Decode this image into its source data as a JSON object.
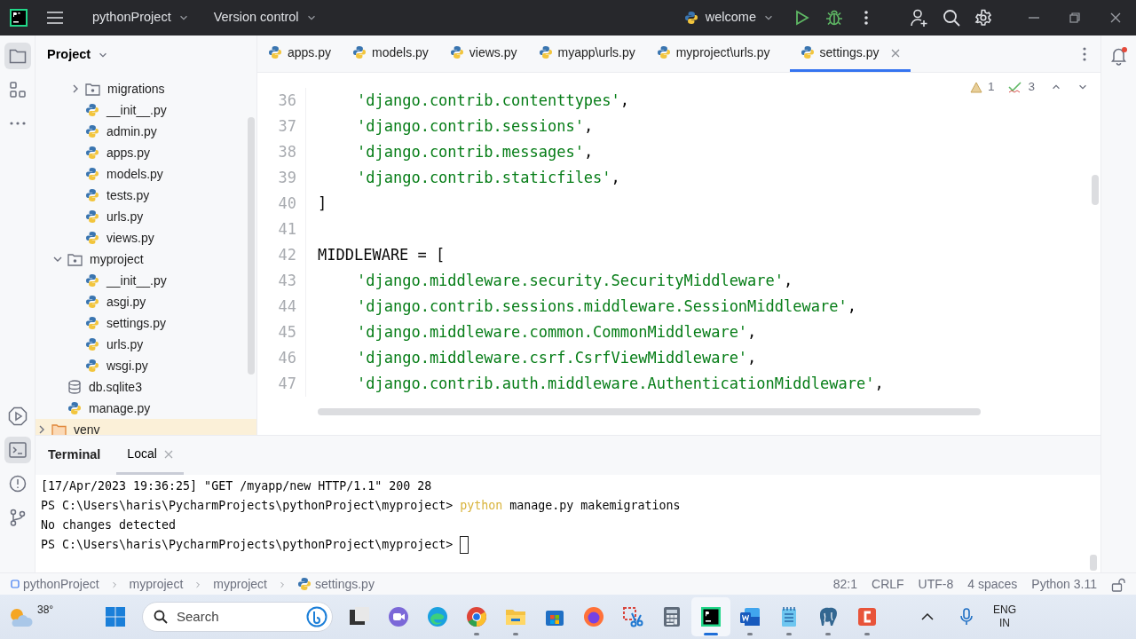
{
  "title_bar": {
    "project": "pythonProject",
    "vcs": "Version control",
    "run_config": "welcome"
  },
  "project_panel": {
    "title": "Project",
    "tree": [
      {
        "children": [
          {
            "children": [
              {
                "label": "migrations",
                "kind": "package",
                "expanded": false
              },
              {
                "label": "__init__.py",
                "kind": "python"
              },
              {
                "label": "admin.py",
                "kind": "python"
              },
              {
                "label": "apps.py",
                "kind": "python"
              },
              {
                "label": "models.py",
                "kind": "python"
              },
              {
                "label": "tests.py",
                "kind": "python"
              },
              {
                "label": "urls.py",
                "kind": "python"
              },
              {
                "label": "views.py",
                "kind": "python"
              }
            ]
          },
          {
            "label": "myproject",
            "kind": "package",
            "expanded": true,
            "children": [
              {
                "label": "__init__.py",
                "kind": "python"
              },
              {
                "label": "asgi.py",
                "kind": "python"
              },
              {
                "label": "settings.py",
                "kind": "python"
              },
              {
                "label": "urls.py",
                "kind": "python"
              },
              {
                "label": "wsgi.py",
                "kind": "python"
              }
            ]
          },
          {
            "label": "db.sqlite3",
            "kind": "database"
          },
          {
            "label": "manage.py",
            "kind": "python"
          }
        ]
      },
      {
        "label": "venv",
        "kind": "excluded_folder",
        "expanded": false
      }
    ]
  },
  "editor": {
    "tabs": [
      {
        "label": "apps.py",
        "selected": false
      },
      {
        "label": "models.py",
        "selected": false
      },
      {
        "label": "views.py",
        "selected": false
      },
      {
        "label": "myapp\\urls.py",
        "selected": false
      },
      {
        "label": "myproject\\urls.py",
        "selected": false
      },
      {
        "label": "settings.py",
        "selected": true
      }
    ],
    "warnings": "1",
    "weak_warnings": "3",
    "lines": [
      {
        "number": "36",
        "indented": true,
        "segments": [
          {
            "kind": "string",
            "text": "'django.contrib.contenttypes'"
          },
          {
            "kind": "plain",
            "text": ","
          }
        ]
      },
      {
        "number": "37",
        "indented": true,
        "segments": [
          {
            "kind": "string",
            "text": "'django.contrib.sessions'"
          },
          {
            "kind": "plain",
            "text": ","
          }
        ]
      },
      {
        "number": "38",
        "indented": true,
        "segments": [
          {
            "kind": "string",
            "text": "'django.contrib.messages'"
          },
          {
            "kind": "plain",
            "text": ","
          }
        ]
      },
      {
        "number": "39",
        "indented": true,
        "segments": [
          {
            "kind": "string",
            "text": "'django.contrib.staticfiles'"
          },
          {
            "kind": "plain",
            "text": ","
          }
        ]
      },
      {
        "number": "40",
        "indented": false,
        "segments": [
          {
            "kind": "plain",
            "text": "]"
          }
        ]
      },
      {
        "number": "41"
      },
      {
        "number": "42",
        "indented": false,
        "segments": [
          {
            "kind": "plain",
            "text": "MIDDLEWARE = ["
          }
        ]
      },
      {
        "number": "43",
        "indented": true,
        "segments": [
          {
            "kind": "string",
            "text": "'django.middleware.security.SecurityMiddleware'"
          },
          {
            "kind": "plain",
            "text": ","
          }
        ]
      },
      {
        "number": "44",
        "indented": true,
        "segments": [
          {
            "kind": "string",
            "text": "'django.contrib.sessions.middleware.SessionMiddleware'"
          },
          {
            "kind": "plain",
            "text": ","
          }
        ]
      },
      {
        "number": "45",
        "indented": true,
        "segments": [
          {
            "kind": "string",
            "text": "'django.middleware.common.CommonMiddleware'"
          },
          {
            "kind": "plain",
            "text": ","
          }
        ]
      },
      {
        "number": "46",
        "indented": true,
        "segments": [
          {
            "kind": "string",
            "text": "'django.middleware.csrf.CsrfViewMiddleware'"
          },
          {
            "kind": "plain",
            "text": ","
          }
        ]
      },
      {
        "number": "47",
        "indented": true,
        "segments": [
          {
            "kind": "string",
            "text": "'django.contrib.auth.middleware.AuthenticationMiddleware'"
          },
          {
            "kind": "plain",
            "text": ","
          }
        ]
      }
    ]
  },
  "terminal": {
    "title": "Terminal",
    "tabs": [
      {
        "label": "Local",
        "selected": true
      }
    ],
    "lines": [
      {
        "cursor": false,
        "segments": [
          {
            "kind": "output",
            "text": "[17/Apr/2023 19:36:25] \"GET /myapp/new HTTP/1.1\" 200 28"
          }
        ]
      },
      {
        "cursor": false,
        "segments": [
          {
            "kind": "output",
            "text": "PS C:\\Users\\haris\\PycharmProjects\\pythonProject\\myproject>"
          },
          {
            "kind": "command",
            "text": "python"
          },
          {
            "kind": "output",
            "text": "manage.py makemigrations"
          }
        ]
      },
      {
        "cursor": false,
        "segments": [
          {
            "kind": "output",
            "text": "No changes detected"
          }
        ]
      },
      {
        "cursor": true,
        "segments": [
          {
            "kind": "output",
            "text": "PS C:\\Users\\haris\\PycharmProjects\\pythonProject\\myproject>"
          }
        ]
      }
    ]
  },
  "status_bar": {
    "breadcrumbs": [
      {
        "label": "pythonProject",
        "kind": "module"
      },
      {
        "label": "myproject",
        "kind": "plain"
      },
      {
        "label": "myproject",
        "kind": "plain"
      },
      {
        "label": "settings.py",
        "kind": "python"
      }
    ],
    "items": [
      "82:1",
      "CRLF",
      "UTF-8",
      "4 spaces",
      "Python 3.11"
    ]
  },
  "taskbar": {
    "weather": "38°",
    "search": {
      "placeholder": "Search"
    },
    "apps": [
      {
        "kind": "taskview",
        "running": false,
        "active": false
      },
      {
        "kind": "chat",
        "running": false,
        "active": false
      },
      {
        "kind": "edge",
        "running": false,
        "active": false
      },
      {
        "kind": "chrome",
        "running": true,
        "active": false
      },
      {
        "kind": "explorer",
        "running": true,
        "active": false
      },
      {
        "kind": "store",
        "running": false,
        "active": false
      },
      {
        "kind": "firefox",
        "running": false,
        "active": false
      },
      {
        "kind": "snip",
        "running": false,
        "active": false
      },
      {
        "kind": "calculator",
        "running": false,
        "active": false
      },
      {
        "kind": "pycharm",
        "running": true,
        "active": true
      },
      {
        "kind": "word",
        "running": true,
        "active": false
      },
      {
        "kind": "notepad",
        "running": true,
        "active": false
      },
      {
        "kind": "postgres",
        "running": true,
        "active": false
      },
      {
        "kind": "recorder",
        "running": true,
        "active": false
      }
    ],
    "language": [
      "ENG",
      "IN"
    ]
  }
}
